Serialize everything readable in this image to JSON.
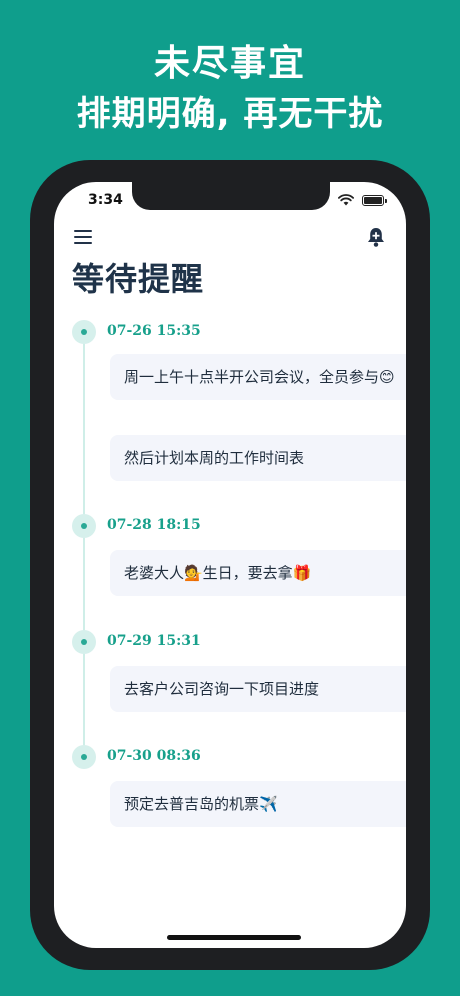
{
  "promo": {
    "line1": "未尽事宜",
    "line2": "排期明确, 再无干扰"
  },
  "status_bar": {
    "time": "3:34"
  },
  "header": {
    "menu_icon": "hamburger-menu-icon",
    "bell_icon": "bell-plus-icon",
    "title": "等待提醒"
  },
  "groups": [
    {
      "date": "07-26 15:35",
      "items": [
        "周一上午十点半开公司会议，全员参与😊",
        "然后计划本周的工作时间表"
      ]
    },
    {
      "date": "07-28 18:15",
      "items": [
        "老婆大人💁生日，要去拿🎁"
      ]
    },
    {
      "date": "07-29 15:31",
      "items": [
        "去客户公司咨询一下项目进度"
      ]
    },
    {
      "date": "07-30 08:36",
      "items": [
        "预定去普吉岛的机票✈️"
      ]
    }
  ],
  "colors": {
    "background": "#0f9e8c",
    "accent": "#17a08b",
    "title": "#1f3349",
    "card": "#f3f5fb"
  }
}
